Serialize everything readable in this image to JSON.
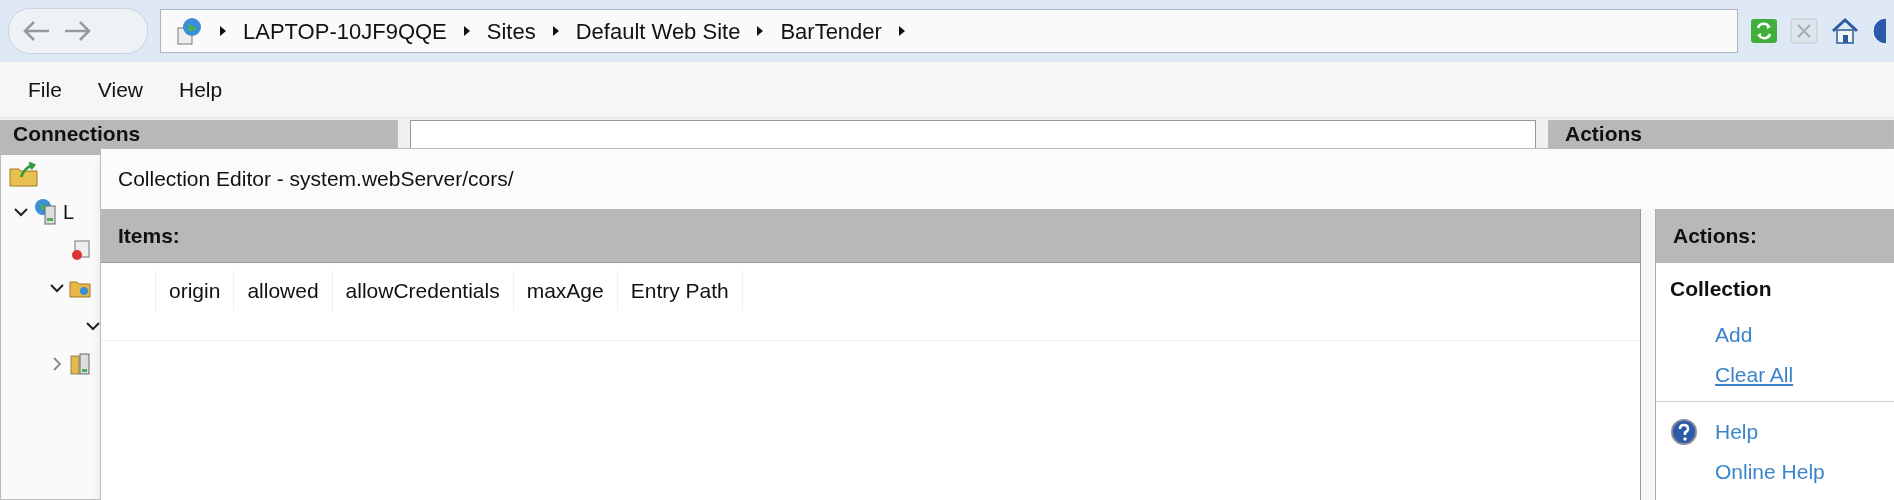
{
  "address_bar": {
    "back_disabled": true,
    "forward_disabled": true,
    "breadcrumb": [
      "LAPTOP-10JF9QQE",
      "Sites",
      "Default Web Site",
      "BarTender"
    ],
    "tools": [
      {
        "kind": "refresh",
        "disabled": false
      },
      {
        "kind": "stop",
        "disabled": true
      },
      {
        "kind": "home",
        "disabled": false
      },
      {
        "kind": "help",
        "disabled": false
      }
    ]
  },
  "menu": [
    "File",
    "View",
    "Help"
  ],
  "connections": {
    "title": "Connections",
    "tree": [
      {
        "label": "L",
        "kind": "server",
        "expanded": true,
        "children": [
          {
            "kind": "pool"
          },
          {
            "kind": "folder",
            "expanded": true,
            "children": [
              {
                "expanded": true
              }
            ]
          },
          {
            "kind": "sites",
            "expanded": false
          }
        ]
      }
    ]
  },
  "actions_behind": {
    "title": "Actions"
  },
  "dialog": {
    "title": "Collection Editor - system.webServer/cors/",
    "items_title": "Items:",
    "columns": [
      "origin",
      "allowed",
      "allowCredentials",
      "maxAge",
      "Entry Path"
    ],
    "actions_title": "Actions:",
    "action_groups": [
      {
        "title": "Collection",
        "items": [
          {
            "label": "Add",
            "hover": false
          },
          {
            "label": "Clear All",
            "hover": true
          }
        ]
      },
      {
        "items": [
          {
            "label": "Help",
            "kind": "help",
            "hover": false
          },
          {
            "label": "Online Help",
            "hover": false
          }
        ]
      }
    ]
  }
}
